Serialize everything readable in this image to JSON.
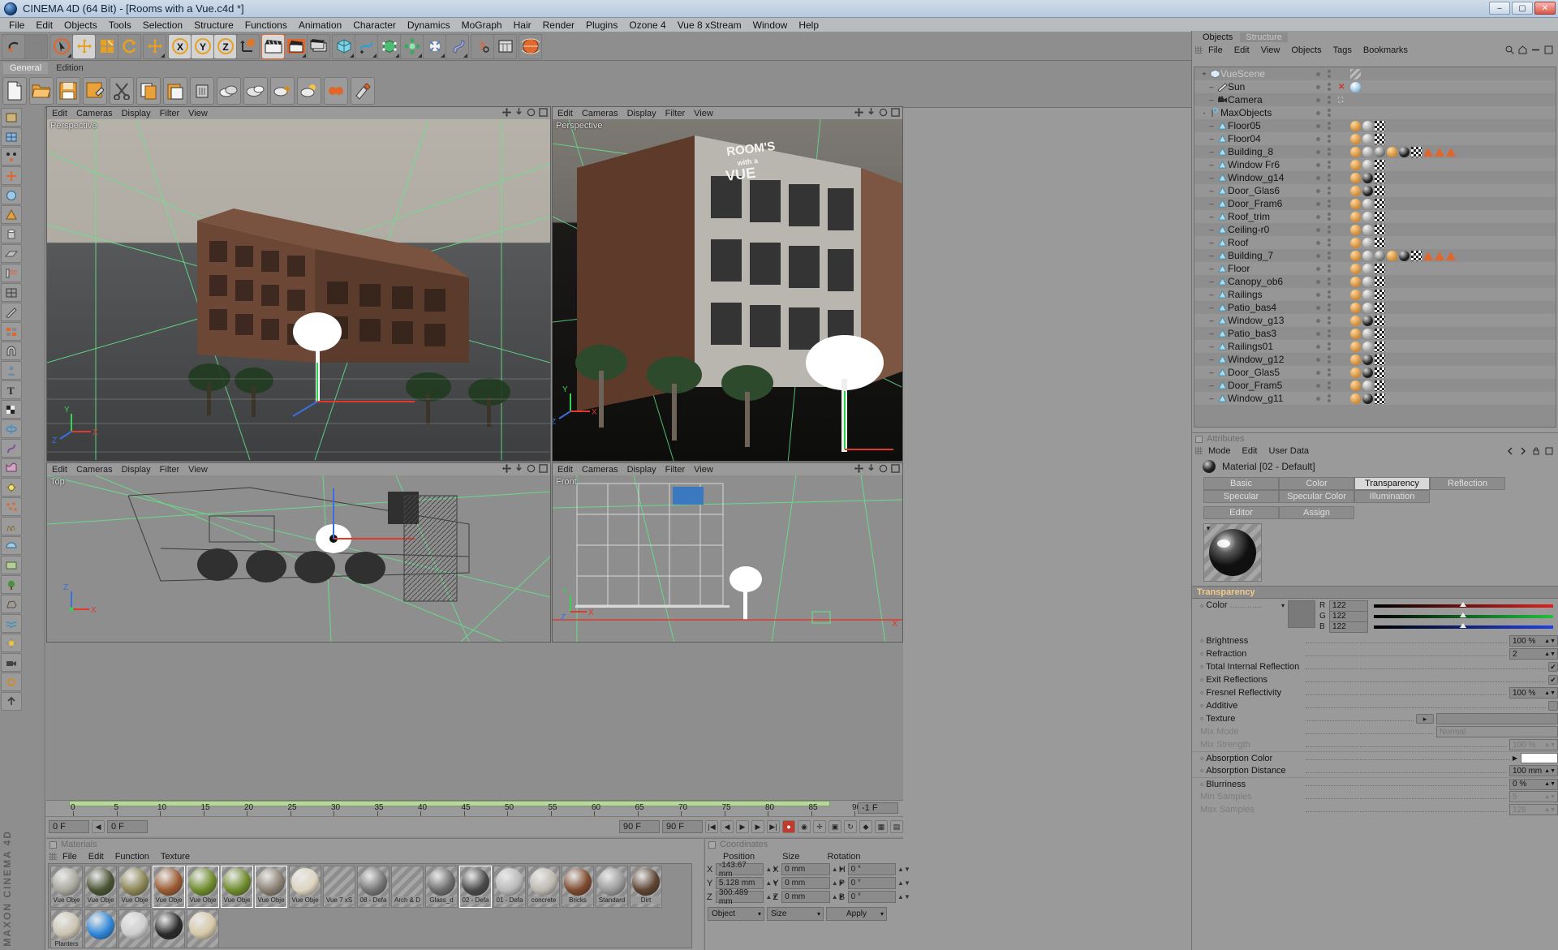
{
  "window": {
    "title": "CINEMA 4D (64 Bit) - [Rooms with a Vue.c4d *]",
    "minimize": "–",
    "maximize": "▢",
    "close": "✕"
  },
  "menubar": [
    "File",
    "Edit",
    "Objects",
    "Tools",
    "Selection",
    "Structure",
    "Functions",
    "Animation",
    "Character",
    "Dynamics",
    "MoGraph",
    "Hair",
    "Render",
    "Plugins",
    "Ozone 4",
    "Vue 8 xStream",
    "Window",
    "Help"
  ],
  "layout_tabs": [
    {
      "label": "General",
      "active": true
    },
    {
      "label": "Edition",
      "active": false
    }
  ],
  "viewports": [
    {
      "name": "Perspective",
      "menu": [
        "Edit",
        "Cameras",
        "Display",
        "Filter",
        "View"
      ]
    },
    {
      "name": "Perspective",
      "menu": [
        "Edit",
        "Cameras",
        "Display",
        "Filter",
        "View"
      ]
    },
    {
      "name": "Top",
      "menu": [
        "Edit",
        "Cameras",
        "Display",
        "Filter",
        "View"
      ]
    },
    {
      "name": "Front",
      "menu": [
        "Edit",
        "Cameras",
        "Display",
        "Filter",
        "View"
      ]
    }
  ],
  "timeline": {
    "ticks": [
      "0",
      "5",
      "10",
      "15",
      "20",
      "25",
      "30",
      "35",
      "40",
      "45",
      "50",
      "55",
      "60",
      "65",
      "70",
      "75",
      "80",
      "85",
      "90"
    ],
    "current_frame_right": "-1 F",
    "field_left": "0 F",
    "field_left2": "0 F",
    "field_end": "90 F",
    "field_end2": "90 F"
  },
  "materials_panel": {
    "title": "Materials",
    "menu": [
      "File",
      "Edit",
      "Function",
      "Texture"
    ],
    "items": [
      {
        "name": "Vue Obje",
        "color": "#a8a79d",
        "selected": false
      },
      {
        "name": "Vue Obje",
        "color": "#4b5434",
        "selected": false
      },
      {
        "name": "Vue Obje",
        "color": "#8b8555",
        "selected": false
      },
      {
        "name": "Vue Obje",
        "color": "#9b5a33",
        "selected": true
      },
      {
        "name": "Vue Obje",
        "color": "#6f8c2c",
        "selected": true
      },
      {
        "name": "Vue Obje",
        "color": "#6f8c2c",
        "selected": true
      },
      {
        "name": "Vue Obje",
        "color": "#8a8073",
        "selected": true
      },
      {
        "name": "Vue Obje",
        "color": "#ddd4c0",
        "selected": false
      },
      {
        "name": "Vue 7 xS",
        "color": "none",
        "selected": false
      },
      {
        "name": "08 - Defa",
        "color": "#767676",
        "selected": false
      },
      {
        "name": "Arch & D",
        "color": "none",
        "selected": false
      },
      {
        "name": "Glass_d",
        "color": "#6d6d6d",
        "selected": false
      },
      {
        "name": "02 - Defa",
        "color": "#4a4a4a",
        "selected": true
      },
      {
        "name": "01 - Defa",
        "color": "#b9b9b9",
        "selected": false
      },
      {
        "name": "concrete",
        "color": "#bdb9b0",
        "selected": false
      },
      {
        "name": "Bricks",
        "color": "#7d4a2e",
        "selected": false
      },
      {
        "name": "Standard",
        "color": "#9a9a9a",
        "selected": false
      },
      {
        "name": "Dirt",
        "color": "#5d4433",
        "selected": false
      },
      {
        "name": "Planters",
        "color": "#cbc3b1",
        "selected": false
      },
      {
        "name": "",
        "color": "#2f86d8",
        "selected": false
      },
      {
        "name": "",
        "color": "#cdcdcd",
        "selected": false
      },
      {
        "name": "",
        "color": "#2b2b2b",
        "selected": false
      },
      {
        "name": "",
        "color": "#d6c8a8",
        "selected": false
      }
    ]
  },
  "coordinates": {
    "title": "Coordinates",
    "columns": [
      "Position",
      "Size",
      "Rotation"
    ],
    "rows": [
      {
        "axis": "X",
        "position": "-143.67 mm",
        "size": "0 mm",
        "rot_label": "H",
        "rotation": "0 °"
      },
      {
        "axis": "Y",
        "position": "5.128 mm",
        "size": "0 mm",
        "rot_label": "P",
        "rotation": "0 °"
      },
      {
        "axis": "Z",
        "position": "300.489 mm",
        "size": "0 mm",
        "rot_label": "B",
        "rotation": "0 °"
      }
    ],
    "mode_left": "Object",
    "mode_right": "Size",
    "apply": "Apply"
  },
  "object_manager": {
    "tabs": [
      {
        "label": "Objects",
        "active": true
      },
      {
        "label": "Structure",
        "active": false
      }
    ],
    "menu": [
      "File",
      "Edit",
      "View",
      "Objects",
      "Tags",
      "Bookmarks"
    ],
    "items": [
      {
        "name": "VueScene",
        "icon": "cube-icon",
        "depth": 0,
        "expander": "+",
        "dim": true,
        "tags": [
          "hatch"
        ]
      },
      {
        "name": "Sun",
        "icon": "sun-icon",
        "depth": 1,
        "expander": "",
        "dim": false,
        "x": true,
        "tags": [
          "light"
        ]
      },
      {
        "name": "Camera",
        "icon": "camera-icon",
        "depth": 1,
        "expander": "",
        "dim": false,
        "target": true,
        "tags": []
      },
      {
        "name": "MaxObjects",
        "icon": "null-icon",
        "depth": 0,
        "expander": "-",
        "dim": false,
        "tags": []
      },
      {
        "name": "Floor05",
        "icon": "poly-icon",
        "depth": 1,
        "tags": [
          "ball-light",
          "checker"
        ]
      },
      {
        "name": "Floor04",
        "icon": "poly-icon",
        "depth": 1,
        "tags": [
          "ball-light",
          "checker"
        ]
      },
      {
        "name": "Building_8",
        "icon": "poly-icon",
        "depth": 1,
        "tags": [
          "ball-light",
          "ball-grey",
          "ball-dark",
          "checker",
          "tri",
          "tri",
          "tri"
        ]
      },
      {
        "name": "Window Fr6",
        "icon": "poly-icon",
        "depth": 1,
        "tags": [
          "ball-light",
          "checker"
        ]
      },
      {
        "name": "Window_g14",
        "icon": "poly-icon",
        "depth": 1,
        "tags": [
          "ball-dark",
          "checker"
        ]
      },
      {
        "name": "Door_Glas6",
        "icon": "poly-icon",
        "depth": 1,
        "tags": [
          "ball-dark",
          "checker"
        ]
      },
      {
        "name": "Door_Fram6",
        "icon": "poly-icon",
        "depth": 1,
        "tags": [
          "ball-light",
          "checker"
        ]
      },
      {
        "name": "Roof_trim",
        "icon": "poly-icon",
        "depth": 1,
        "tags": [
          "ball-light",
          "checker"
        ]
      },
      {
        "name": "Ceiling-r0",
        "icon": "poly-icon",
        "depth": 1,
        "tags": [
          "ball-light",
          "checker"
        ]
      },
      {
        "name": "Roof",
        "icon": "poly-icon",
        "depth": 1,
        "tags": [
          "ball-light",
          "checker"
        ]
      },
      {
        "name": "Building_7",
        "icon": "poly-icon",
        "depth": 1,
        "tags": [
          "ball-light",
          "ball-grey",
          "ball-dark",
          "checker",
          "tri",
          "tri",
          "tri"
        ]
      },
      {
        "name": "Floor",
        "icon": "poly-icon",
        "depth": 1,
        "tags": [
          "ball-light",
          "checker"
        ]
      },
      {
        "name": "Canopy_ob6",
        "icon": "poly-icon",
        "depth": 1,
        "tags": [
          "ball-light",
          "checker"
        ]
      },
      {
        "name": "Railings",
        "icon": "poly-icon",
        "depth": 1,
        "tags": [
          "ball-light",
          "checker"
        ]
      },
      {
        "name": "Patio_bas4",
        "icon": "poly-icon",
        "depth": 1,
        "tags": [
          "ball-light",
          "checker"
        ]
      },
      {
        "name": "Window_g13",
        "icon": "poly-icon",
        "depth": 1,
        "tags": [
          "ball-dark",
          "checker"
        ]
      },
      {
        "name": "Patio_bas3",
        "icon": "poly-icon",
        "depth": 1,
        "tags": [
          "ball-light",
          "checker"
        ]
      },
      {
        "name": "Railings01",
        "icon": "poly-icon",
        "depth": 1,
        "tags": [
          "ball-light",
          "checker"
        ]
      },
      {
        "name": "Window_g12",
        "icon": "poly-icon",
        "depth": 1,
        "tags": [
          "ball-dark",
          "checker"
        ]
      },
      {
        "name": "Door_Glas5",
        "icon": "poly-icon",
        "depth": 1,
        "tags": [
          "ball-dark",
          "checker"
        ]
      },
      {
        "name": "Door_Fram5",
        "icon": "poly-icon",
        "depth": 1,
        "tags": [
          "ball-light",
          "checker"
        ]
      },
      {
        "name": "Window_g11",
        "icon": "poly-icon",
        "depth": 1,
        "tags": [
          "ball-dark",
          "checker"
        ]
      }
    ]
  },
  "attributes": {
    "title": "Attributes",
    "menu": [
      "Mode",
      "Edit",
      "User Data"
    ],
    "object_title": "Material [02 - Default]",
    "tabs_row1": [
      {
        "label": "Basic",
        "active": false
      },
      {
        "label": "Color",
        "active": false
      },
      {
        "label": "Transparency",
        "active": true
      },
      {
        "label": "Reflection",
        "active": false
      },
      {
        "label": "Specular",
        "active": false
      },
      {
        "label": "Specular Color",
        "active": false
      },
      {
        "label": "Illumination",
        "active": false
      }
    ],
    "tabs_row2": [
      {
        "label": "Editor",
        "active": false
      },
      {
        "label": "Assign",
        "active": false
      }
    ],
    "section_title": "Transparency",
    "color": {
      "label": "Color",
      "r_label": "R",
      "g_label": "G",
      "b_label": "B",
      "r": "122",
      "g": "122",
      "b": "122",
      "swatch": "#7a7a7a"
    },
    "properties": [
      {
        "label": "Brightness",
        "value": "100 %",
        "type": "number",
        "dim": false
      },
      {
        "label": "Refraction",
        "value": "2",
        "type": "number",
        "dim": false
      },
      {
        "label": "Total Internal Reflection",
        "value": "✔",
        "type": "check",
        "dim": false
      },
      {
        "label": "Exit Reflections",
        "value": "✔",
        "type": "check",
        "dim": false
      },
      {
        "label": "Fresnel Reflectivity",
        "value": "100 %",
        "type": "number",
        "dim": false
      },
      {
        "label": "Additive",
        "value": "",
        "type": "check",
        "dim": false
      },
      {
        "label": "Texture",
        "value": "",
        "type": "texture",
        "dim": false
      },
      {
        "label": "Mix Mode",
        "value": "Normal",
        "type": "select",
        "dim": true
      },
      {
        "label": "Mix Strength",
        "value": "100 %",
        "type": "number",
        "dim": true
      },
      {
        "label": "Absorption Color",
        "value": "#ffffff",
        "type": "swatch",
        "dim": false
      },
      {
        "label": "Absorption Distance",
        "value": "100 mm",
        "type": "number",
        "dim": false
      },
      {
        "label": "Blurriness",
        "value": "0 %",
        "type": "number",
        "dim": false
      },
      {
        "label": "Min Samples",
        "value": "5",
        "type": "number",
        "dim": true
      },
      {
        "label": "Max Samples",
        "value": "128",
        "type": "number",
        "dim": true
      }
    ]
  },
  "branding": {
    "maxon": "MAXON CINEMA 4D"
  }
}
